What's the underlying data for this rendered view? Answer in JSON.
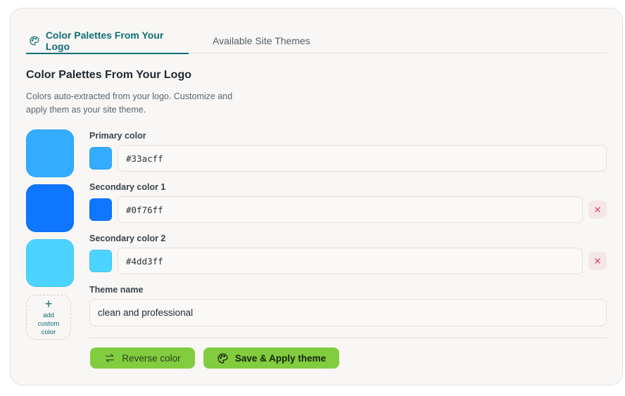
{
  "tabs": {
    "active_label": "Color Palettes From Your Logo",
    "inactive_label": "Available Site Themes",
    "active_icon": "palette-icon"
  },
  "section": {
    "title": "Color Palettes From Your Logo",
    "description": "Colors auto-extracted from your logo. Customize and apply them as your site theme."
  },
  "colors": {
    "primary": {
      "label": "Primary color",
      "value": "#33acff",
      "hex": "#33acff"
    },
    "secondary1": {
      "label": "Secondary color 1",
      "value": "#0f76ff",
      "hex": "#0f76ff"
    },
    "secondary2": {
      "label": "Secondary color 2",
      "value": "#4dd3ff",
      "hex": "#4dd3ff"
    }
  },
  "add_custom": {
    "plus": "+",
    "label": "add custom color"
  },
  "remove_icon": "close-icon",
  "theme": {
    "label": "Theme name",
    "value": "clean and professional"
  },
  "actions": {
    "reverse_label": "Reverse color",
    "reverse_icon": "swap-arrows-icon",
    "save_label": "Save & Apply theme",
    "save_icon": "palette-icon"
  },
  "accent": {
    "teal": "#0e6f73",
    "green": "#82cc3f"
  }
}
